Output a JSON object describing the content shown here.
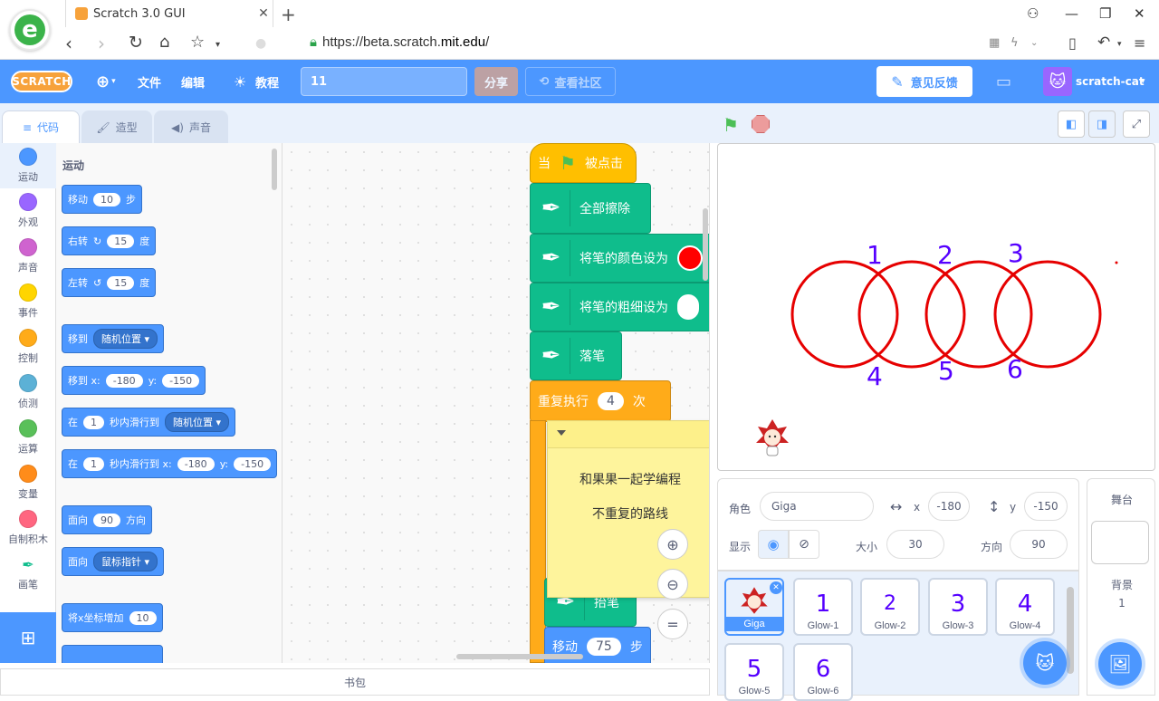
{
  "browser": {
    "tab_title": "Scratch 3.0 GUI",
    "url_prefix": "https://beta.scratch.",
    "url_domain": "mit.edu",
    "url_suffix": "/"
  },
  "menubar": {
    "logo": "SCRATCH",
    "file": "文件",
    "edit": "编辑",
    "tutorials": "教程",
    "project_title": "11",
    "share": "分享",
    "see_community": "查看社区",
    "feedback": "意见反馈",
    "username": "scratch-cat"
  },
  "tabs": {
    "code": "代码",
    "costumes": "造型",
    "sounds": "声音"
  },
  "categories": [
    {
      "label": "运动",
      "color": "#4c97ff"
    },
    {
      "label": "外观",
      "color": "#9966ff"
    },
    {
      "label": "声音",
      "color": "#cf63cf"
    },
    {
      "label": "事件",
      "color": "#ffd500"
    },
    {
      "label": "控制",
      "color": "#ffab19"
    },
    {
      "label": "侦测",
      "color": "#5cb1d6"
    },
    {
      "label": "运算",
      "color": "#59c059"
    },
    {
      "label": "变量",
      "color": "#ff8c1a"
    },
    {
      "label": "自制积木",
      "color": "#ff6680"
    },
    {
      "label": "画笔",
      "color": "#0fbd8c"
    }
  ],
  "palette": {
    "section": "运动",
    "move_a": "移动",
    "move_val": "10",
    "move_b": "步",
    "turn_right_a": "右转",
    "turn_right_val": "15",
    "turn_right_b": "度",
    "turn_left_a": "左转",
    "turn_left_val": "15",
    "turn_left_b": "度",
    "goto_a": "移到",
    "goto_dd": "随机位置",
    "gotoxy_a": "移到 x:",
    "gotoxy_x": "-180",
    "gotoxy_y_lbl": "y:",
    "gotoxy_y": "-150",
    "glide_a": "在",
    "glide_val": "1",
    "glide_b": "秒内滑行到",
    "glide_dd": "随机位置",
    "glidexy_a": "在",
    "glidexy_val": "1",
    "glidexy_b": "秒内滑行到 x:",
    "glidexy_x": "-180",
    "glidexy_y_lbl": "y:",
    "glidexy_y": "-150",
    "point_a": "面向",
    "point_val": "90",
    "point_b": "方向",
    "pointto_a": "面向",
    "pointto_dd": "鼠标指针",
    "changex_a": "将x坐标增加",
    "changex_val": "10"
  },
  "script": {
    "hat_a": "当",
    "hat_b": "被点击",
    "clear": "全部擦除",
    "set_color": "将笔的颜色设为",
    "set_size": "将笔的粗细设为",
    "pen_down": "落笔",
    "repeat_a": "重复执行",
    "repeat_val": "4",
    "repeat_b": "次",
    "pen_up": "抬笔",
    "move_a": "移动",
    "move_val": "75",
    "move_b": "步"
  },
  "note": {
    "line1": "和果果一起学编程",
    "line2": "不重复的路线"
  },
  "backpack": "书包",
  "stage": {
    "labels_top": [
      "1",
      "2",
      "3"
    ],
    "labels_bottom": [
      "4",
      "5",
      "6"
    ]
  },
  "sprite_info": {
    "sprite_label": "角色",
    "sprite_name": "Giga",
    "x_label": "x",
    "x_value": "-180",
    "y_label": "y",
    "y_value": "-150",
    "show_label": "显示",
    "size_label": "大小",
    "size_value": "30",
    "direction_label": "方向",
    "direction_value": "90"
  },
  "sprites": [
    {
      "name": "Giga",
      "glyph": ""
    },
    {
      "name": "Glow-1",
      "glyph": "1"
    },
    {
      "name": "Glow-2",
      "glyph": "2"
    },
    {
      "name": "Glow-3",
      "glyph": "3"
    },
    {
      "name": "Glow-4",
      "glyph": "4"
    },
    {
      "name": "Glow-5",
      "glyph": "5"
    },
    {
      "name": "Glow-6",
      "glyph": "6"
    }
  ],
  "stage_pane": {
    "title": "舞台",
    "backdrop_label": "背景",
    "backdrop_count": "1"
  },
  "colors": {
    "accent": "#4c97ff",
    "circle": "#e60000",
    "label": "#5500ff"
  }
}
